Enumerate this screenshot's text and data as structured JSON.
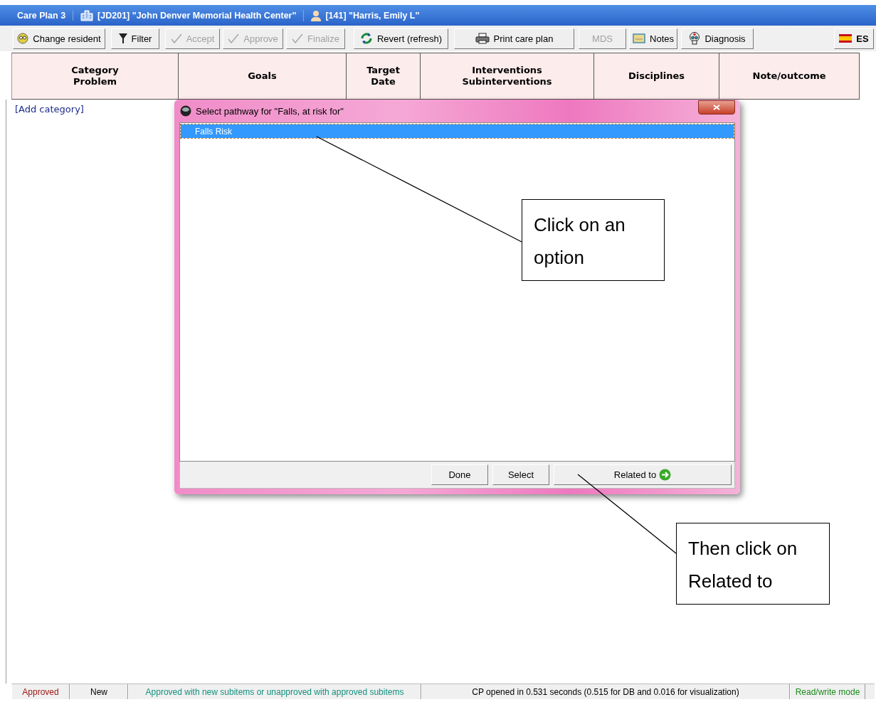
{
  "title_bar": {
    "app": "Care Plan 3",
    "facility": "[JD201] \"John Denver Memorial Health Center\"",
    "resident": "[141] \"Harris, Emily L\""
  },
  "toolbar": [
    {
      "label": "Change resident",
      "kind": "resident",
      "disabled": false
    },
    {
      "label": "Filter",
      "kind": "filter",
      "disabled": false
    },
    {
      "label": "Accept",
      "kind": "check",
      "disabled": true
    },
    {
      "label": "Approve",
      "kind": "check",
      "disabled": true
    },
    {
      "label": "Finalize",
      "kind": "check",
      "disabled": true
    },
    {
      "label": "Revert (refresh)",
      "kind": "revert",
      "disabled": false
    },
    {
      "label": "Print care plan",
      "kind": "print",
      "disabled": false
    },
    {
      "label": "MDS",
      "kind": "plain",
      "disabled": true
    },
    {
      "label": "Notes",
      "kind": "notes",
      "disabled": false
    },
    {
      "label": "Diagnosis",
      "kind": "diagnosis",
      "disabled": false
    }
  ],
  "language_button": "ES",
  "table": {
    "columns": [
      "Category\nProblem",
      "Goals",
      "Target\nDate",
      "Interventions\nSubinterventions",
      "Disciplines",
      "Note/outcome"
    ],
    "add_link": "[Add category]"
  },
  "dialog": {
    "title": "Select pathway for \"Falls, at risk for\"",
    "items": [
      {
        "label": "Falls Risk",
        "selected": true
      }
    ],
    "buttons": [
      {
        "label": "Done",
        "kind": "plain"
      },
      {
        "label": "Select",
        "kind": "plain"
      },
      {
        "label": "Related to",
        "kind": "arrow"
      }
    ]
  },
  "callouts": [
    "Click on an option",
    "Then click on Related to"
  ],
  "status_bar": [
    {
      "text": "Approved",
      "color": "#a01818"
    },
    {
      "text": "New",
      "color": "#000000"
    },
    {
      "text": "Approved with new subitems or unapproved with approved subitems",
      "color": "#14907e"
    },
    {
      "text": "CP opened in 0.531 seconds (0.515 for DB and 0.016 for visualization)",
      "color": "#000000"
    },
    {
      "text": "Read/write mode",
      "color": "#1d8a1d"
    }
  ]
}
